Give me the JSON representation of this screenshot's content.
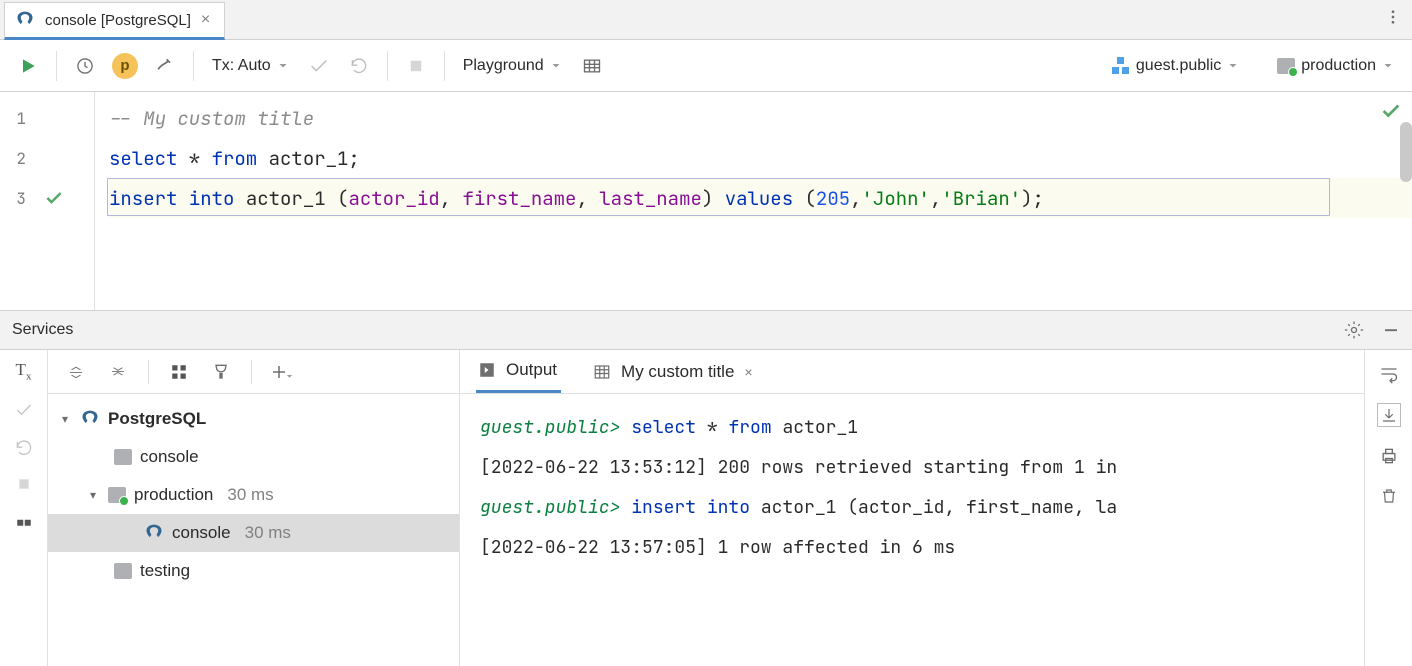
{
  "tab": {
    "title": "console [PostgreSQL]"
  },
  "toolbar": {
    "tx_label": "Tx: Auto",
    "playground_label": "Playground",
    "schema_label": "guest.public",
    "datasource_label": "production",
    "p_badge": "p"
  },
  "editor": {
    "lines": [
      {
        "n": "1",
        "kind": "comment",
        "text": "-- My custom title"
      },
      {
        "n": "2",
        "kind": "select"
      },
      {
        "n": "3",
        "kind": "insert",
        "marker": true
      }
    ],
    "sql": {
      "select_kw": "select",
      "star": " * ",
      "from_kw": "from",
      "table": " actor_1",
      "semi": ";",
      "insert_kw": "insert",
      "into_kw": " into",
      "col1": "actor_id",
      "col2": "first_name",
      "col3": "last_name",
      "values_kw": "values",
      "num": "205",
      "str1": "'John'",
      "str2": "'Brian'"
    }
  },
  "services": {
    "title": "Services",
    "tree": {
      "root": "PostgreSQL",
      "console": "console",
      "production": "production",
      "production_ms": "30 ms",
      "prod_console": "console",
      "prod_console_ms": "30 ms",
      "testing": "testing"
    },
    "tabs": {
      "output": "Output",
      "custom": "My custom title"
    },
    "output": {
      "prompt": "guest.public>",
      "line1_sql_select": "select",
      "line1_sql_star": " * ",
      "line1_sql_from": "from",
      "line1_sql_table": " actor_1",
      "line2": "[2022-06-22 13:53:12] 200 rows retrieved starting from 1 in",
      "line3_sql_insert": "insert",
      "line3_sql_into": " into",
      "line3_sql_rest": " actor_1 (actor_id, first_name, la",
      "line4": "[2022-06-22 13:57:05] 1 row affected in 6 ms"
    }
  }
}
